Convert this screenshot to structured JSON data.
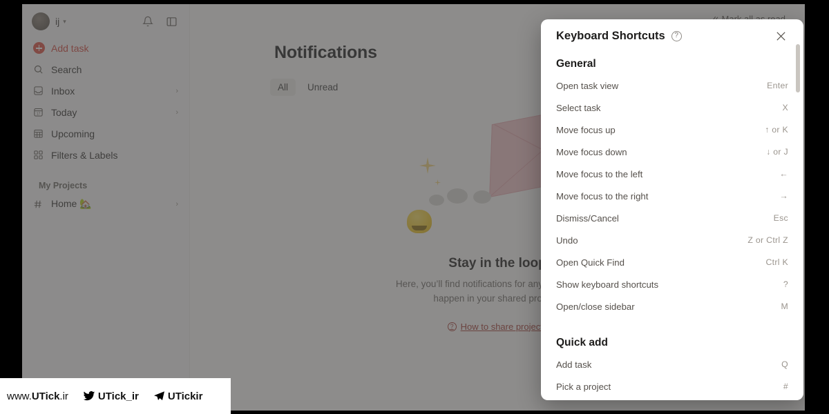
{
  "sidebar": {
    "user": {
      "name": "ij",
      "avatar_initial": "",
      "caret_icon": "chevron-down-icon"
    },
    "actions": [
      {
        "name": "notifications-bell",
        "icon": "bell-icon"
      },
      {
        "name": "toggle-sidebar",
        "icon": "sidebar-panel-icon"
      }
    ],
    "add_task": {
      "label": "Add task",
      "color": "#dc4c3e"
    },
    "items": [
      {
        "label": "Search",
        "icon": "search-icon",
        "chevron": ""
      },
      {
        "label": "Inbox",
        "icon": "inbox-icon",
        "chevron": "›"
      },
      {
        "label": "Today",
        "icon": "calendar-today-icon",
        "chevron": "›"
      },
      {
        "label": "Upcoming",
        "icon": "calendar-grid-icon",
        "chevron": ""
      },
      {
        "label": "Filters & Labels",
        "icon": "filters-labels-icon",
        "chevron": ""
      }
    ],
    "projects_section": {
      "title": "My Projects",
      "items": [
        {
          "label": "Home 🏡",
          "icon": "hash-icon",
          "chevron": "›"
        }
      ]
    }
  },
  "main": {
    "page_title": "Notifications",
    "mark_all_read": "Mark all as read",
    "tabs": [
      {
        "label": "All",
        "active": true
      },
      {
        "label": "Unread",
        "active": false
      }
    ],
    "empty_state": {
      "title": "Stay in the loop",
      "text": "Here, you’ll find notifications for any changes that happen in your shared projects",
      "link": "How to share projects"
    }
  },
  "modal": {
    "title": "Keyboard Shortcuts",
    "help_icon": "question-mark-circle-icon",
    "close_icon": "close-icon",
    "groups": [
      {
        "title": "General",
        "shortcuts": [
          {
            "label": "Open task view",
            "keys": "Enter"
          },
          {
            "label": "Select task",
            "keys": "X"
          },
          {
            "label": "Move focus up",
            "keys": "↑ or K"
          },
          {
            "label": "Move focus down",
            "keys": "↓ or J"
          },
          {
            "label": "Move focus to the left",
            "keys": "←"
          },
          {
            "label": "Move focus to the right",
            "keys": "→"
          },
          {
            "label": "Dismiss/Cancel",
            "keys": "Esc"
          },
          {
            "label": "Undo",
            "keys": "Z or Ctrl Z"
          },
          {
            "label": "Open Quick Find",
            "keys": "Ctrl K"
          },
          {
            "label": "Show keyboard shortcuts",
            "keys": "?"
          },
          {
            "label": "Open/close sidebar",
            "keys": "M"
          }
        ]
      },
      {
        "title": "Quick add",
        "shortcuts": [
          {
            "label": "Add task",
            "keys": "Q"
          },
          {
            "label": "Pick a project",
            "keys": "#"
          }
        ]
      }
    ]
  },
  "watermark": {
    "site_pre": "www.",
    "site_mid": "UTick",
    "site_post": ".ir",
    "twitter": {
      "icon": "twitter-bird-icon",
      "handle": "UTick_ir"
    },
    "telegram": {
      "icon": "telegram-plane-icon",
      "handle": "UTickir"
    }
  }
}
